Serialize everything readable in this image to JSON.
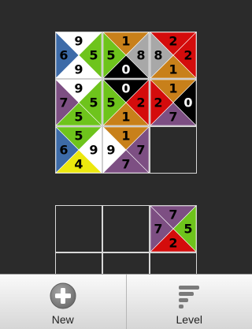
{
  "colors": {
    "1": "#c8801a",
    "2": "#d40c0c",
    "4": "#ece80e",
    "5": "#6ec41c",
    "6": "#3d6ba8",
    "7": "#7d4f83",
    "8": "#a8a8a8",
    "9": "#ffffff",
    "0": "#000000"
  },
  "text_colors": {
    "0": "#ffffff",
    "default": "#000000"
  },
  "board_top": {
    "rows": [
      [
        {
          "top": "9",
          "right": "5",
          "bottom": "9",
          "left": "6"
        },
        {
          "top": "1",
          "right": "8",
          "bottom": "0",
          "left": "5"
        },
        {
          "top": "2",
          "right": "2",
          "bottom": "1",
          "left": "8"
        }
      ],
      [
        {
          "top": "9",
          "right": "5",
          "bottom": "5",
          "left": "7"
        },
        {
          "top": "0",
          "right": "2",
          "bottom": "1",
          "left": "5"
        },
        {
          "top": "1",
          "right": "0",
          "bottom": "7",
          "left": "2"
        }
      ],
      [
        {
          "top": "5",
          "right": "9",
          "bottom": "4",
          "left": "6"
        },
        {
          "top": "1",
          "right": "7",
          "bottom": "7",
          "left": "9"
        },
        null
      ]
    ]
  },
  "board_bottom": {
    "rows": [
      [
        null,
        null,
        {
          "top": "7",
          "right": "5",
          "bottom": "2",
          "left": "7"
        }
      ],
      [
        null,
        null,
        null
      ]
    ]
  },
  "toolbar": {
    "new_label": "New",
    "new_icon": "add-circle-icon",
    "level_label": "Level",
    "level_icon": "level-bars-icon"
  }
}
